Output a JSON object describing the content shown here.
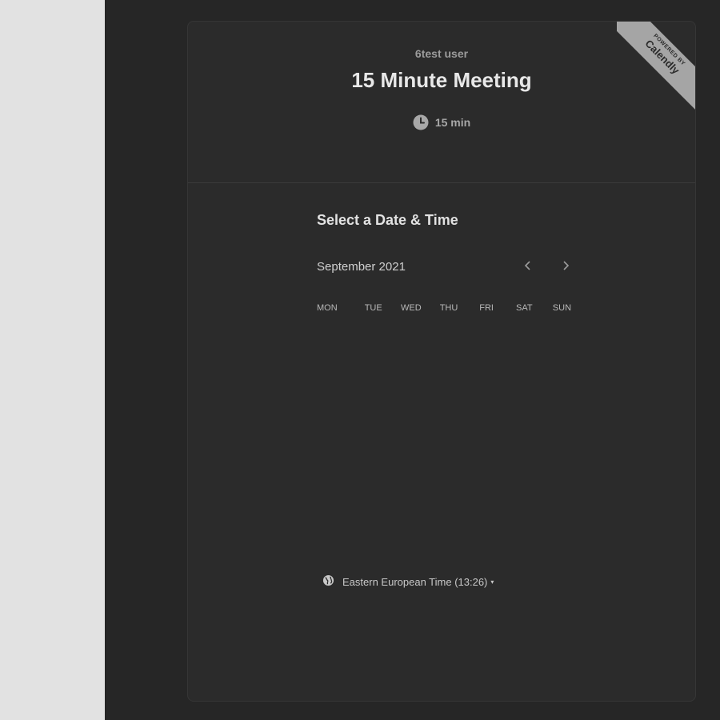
{
  "event": {
    "host_name": "6test user",
    "title": "15 Minute Meeting",
    "duration": "15 min",
    "duration_icon": "clock-icon"
  },
  "badge": {
    "powered_by": "POWERED BY",
    "brand": "Calendly"
  },
  "calendar": {
    "section_title": "Select a Date & Time",
    "month_label": "September 2021",
    "prev_icon": "chevron-left-icon",
    "next_icon": "chevron-right-icon",
    "weekdays": [
      "MON",
      "TUE",
      "WED",
      "THU",
      "FRI",
      "SAT",
      "SUN"
    ]
  },
  "timezone": {
    "icon": "globe-icon",
    "label": "Eastern European Time (13:26)",
    "caret": "▾"
  },
  "colors": {
    "page_background": "#e2e2e2",
    "overlay": "#262626",
    "card": "#2b2b2b",
    "ribbon": "#a5a5a5"
  }
}
